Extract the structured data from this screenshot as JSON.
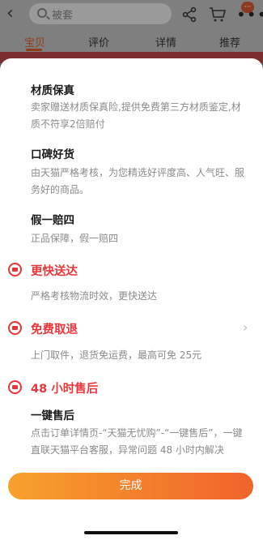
{
  "header": {
    "search_placeholder": "被套",
    "badge_text": "···"
  },
  "tabs": [
    {
      "label": "宝贝"
    },
    {
      "label": "评价"
    },
    {
      "label": "详情"
    },
    {
      "label": "推荐"
    }
  ],
  "sheet": {
    "items": [
      {
        "title": "材质保真",
        "desc": "卖家赠送材质保真险,提供免费第三方材质鉴定,材质不符享2倍赔付"
      },
      {
        "title": "口碑好货",
        "desc": "由天猫严格考核，为您精选好评度高、人气旺、服务好的商品。"
      },
      {
        "title": "假一赔四",
        "desc": "正品保障，假一赔四"
      }
    ],
    "services": [
      {
        "title": "更快送达",
        "desc": "严格考核物流时效，更快送达"
      },
      {
        "title": "免费取退",
        "desc": "上门取件，退货免运费，最高可免 25元"
      },
      {
        "title": "48 小时售后",
        "subtitle": "一键售后",
        "desc": "点击订单详情页-“天猫无忧购”-“一键售后”，一键直联天猫平台客服，异常问题 48 小时内解决"
      }
    ],
    "done_label": "完成"
  },
  "colors": {
    "accent_red": "#e8363b",
    "button_gradient_start": "#f7a12d",
    "button_gradient_end": "#f0632b"
  }
}
